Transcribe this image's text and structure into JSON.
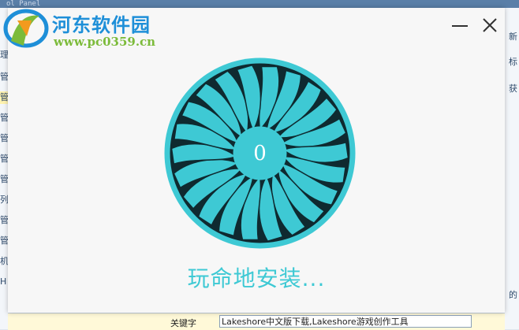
{
  "background_app": {
    "title_fragment": "ol Panel",
    "left_items": [
      "理",
      "管",
      "管",
      "管",
      "管",
      "管",
      "管",
      "列",
      "管",
      "管",
      "机",
      "H"
    ],
    "right_items": [
      "新",
      "标",
      "获",
      "的"
    ],
    "field_label": "关键字",
    "field_value": "Lakeshore中文版下载,Lakeshore游戏创作工具"
  },
  "watermark": {
    "site_name": "河东软件园",
    "site_url": "www.pc0359.cn",
    "logo_icon": "hedong-logo-icon"
  },
  "installer": {
    "progress_value": "0",
    "status_label": "玩命地安装...",
    "minimize_icon": "minimize-icon",
    "close_icon": "close-icon",
    "fan_icon": "turbine-fan-icon",
    "colors": {
      "accent": "#3ec9d4",
      "dark": "#0f2a30",
      "dialog_bg": "#f7f7f7"
    }
  }
}
